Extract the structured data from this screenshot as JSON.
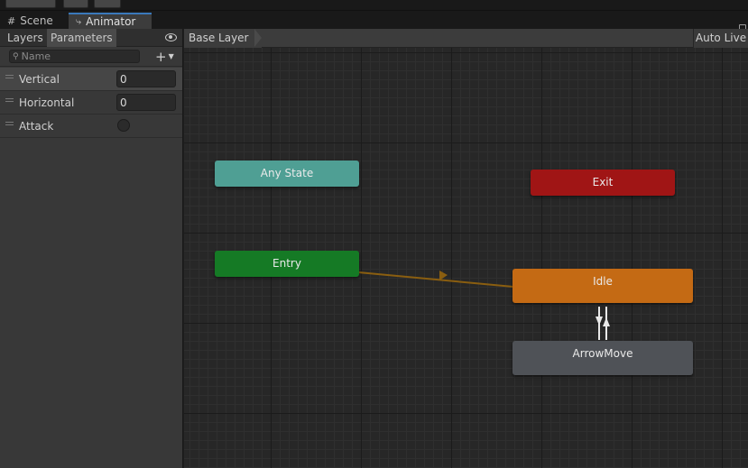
{
  "tabs": [
    {
      "label": "Scene",
      "icon": "grid-icon"
    },
    {
      "label": "Animator",
      "icon": "animator-icon"
    }
  ],
  "left_panel": {
    "tabs": [
      "Layers",
      "Parameters"
    ],
    "search_placeholder": "Name",
    "parameters": [
      {
        "name": "Vertical",
        "value": "0",
        "type": "float"
      },
      {
        "name": "Horizontal",
        "value": "0",
        "type": "float"
      },
      {
        "name": "Attack",
        "type": "trigger"
      }
    ]
  },
  "graph": {
    "breadcrumb": "Base Layer",
    "auto_live": "Auto Live",
    "states": [
      {
        "name": "Any State",
        "color": "#4f9f94"
      },
      {
        "name": "Entry",
        "color": "#157a25"
      },
      {
        "name": "Exit",
        "color": "#a01515"
      },
      {
        "name": "Idle",
        "color": "#c46a14"
      },
      {
        "name": "ArrowMove",
        "color": "#4f5257"
      }
    ],
    "transition_color": "#8a5e10"
  }
}
